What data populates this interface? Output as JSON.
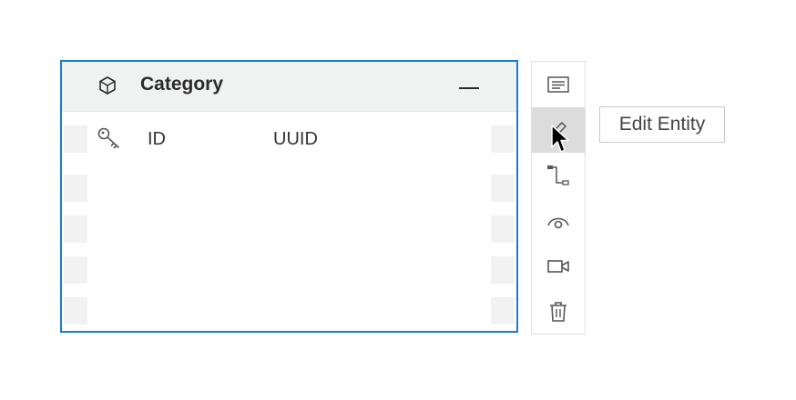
{
  "entity": {
    "title": "Category",
    "icon": "cube-outline-icon",
    "fields": [
      {
        "name": "ID",
        "type": "UUID",
        "icon": "key-icon"
      }
    ],
    "empty_rows": 4
  },
  "toolbar": {
    "items": [
      {
        "icon": "text-lines-icon"
      },
      {
        "icon": "pencil-icon",
        "active": true
      },
      {
        "icon": "relation-connector-icon"
      },
      {
        "icon": "eye-view-icon"
      },
      {
        "icon": "video-camera-icon"
      },
      {
        "icon": "trash-icon"
      }
    ]
  },
  "tooltip": {
    "text": "Edit Entity"
  },
  "colors": {
    "selection_border": "#1a7ccf",
    "header_bg": "#f0f1f1",
    "active_tool_bg": "#dcdcdc"
  }
}
